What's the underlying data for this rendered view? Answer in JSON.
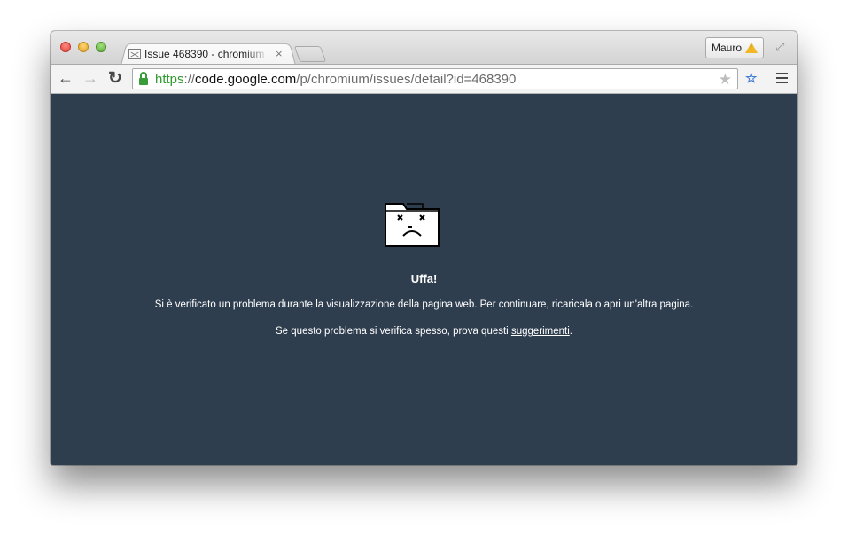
{
  "browser": {
    "tab_title": "Issue 468390 - chromium",
    "tab_close": "×",
    "profile_name": "Mauro",
    "url": {
      "scheme": "https",
      "separator": "://",
      "host": "code.google.com",
      "path": "/p/chromium/issues/detail?id=468390"
    },
    "icons": {
      "back": "arrow-left",
      "forward": "arrow-right",
      "reload": "reload",
      "lock": "lock",
      "star": "star",
      "warning": "warning-triangle",
      "fullscreen": "fullscreen-arrows",
      "menu": "hamburger",
      "extension": "extension"
    }
  },
  "error_page": {
    "title": "Uffa!",
    "message": "Si è verificato un problema durante la visualizzazione della pagina web. Per continuare, ricaricala o apri un'altra pagina.",
    "hint_before": "Se questo problema si verifica spesso, prova questi ",
    "hint_link": "suggerimenti",
    "hint_after": ".",
    "background_color": "#2f3e4f"
  }
}
